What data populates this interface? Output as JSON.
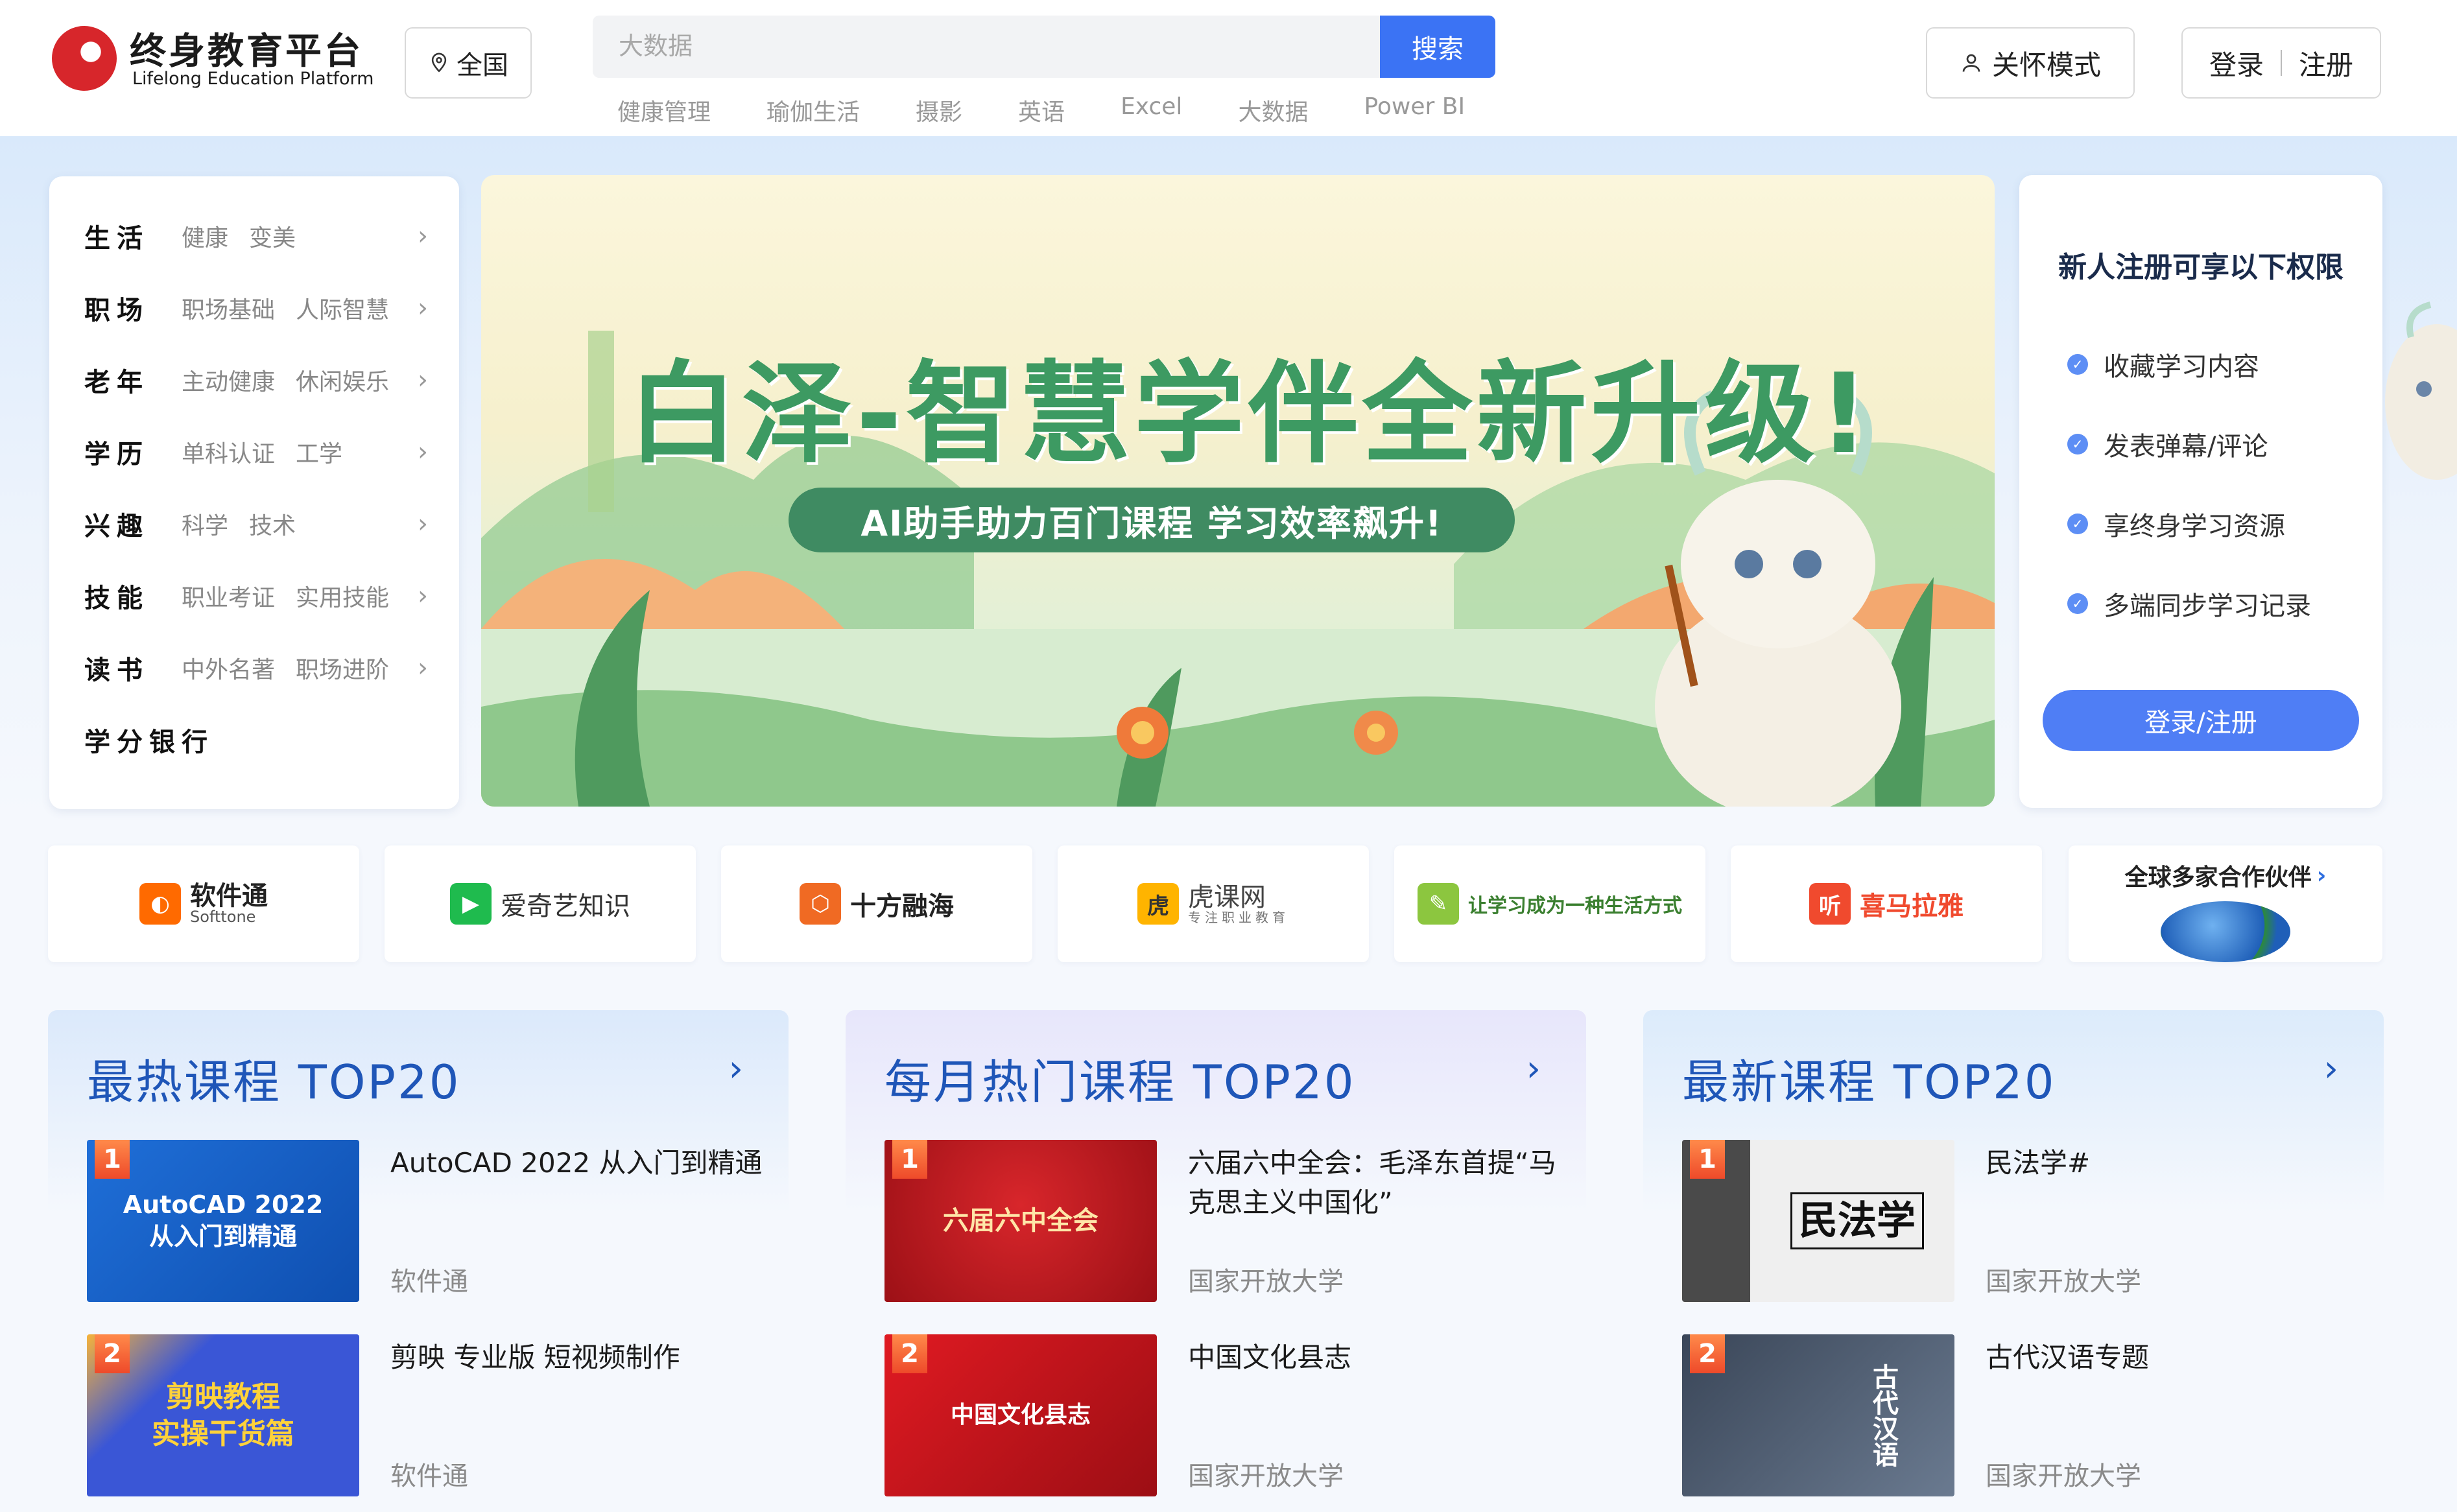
{
  "header": {
    "logo_title": "终身教育平台",
    "logo_subtitle": "Lifelong Education Platform",
    "region_label": "全国",
    "search_placeholder": "大数据",
    "search_button": "搜索",
    "hot_words": [
      "健康管理",
      "瑜伽生活",
      "摄影",
      "英语",
      "Excel",
      "大数据",
      "Power BI"
    ],
    "care_mode": "关怀模式",
    "login": "登录",
    "register": "注册"
  },
  "categories": [
    {
      "name": "生活",
      "subs": [
        "健康",
        "变美"
      ]
    },
    {
      "name": "职场",
      "subs": [
        "职场基础",
        "人际智慧"
      ]
    },
    {
      "name": "老年",
      "subs": [
        "主动健康",
        "休闲娱乐"
      ]
    },
    {
      "name": "学历",
      "subs": [
        "单科认证",
        "工学"
      ]
    },
    {
      "name": "兴趣",
      "subs": [
        "科学",
        "技术"
      ]
    },
    {
      "name": "技能",
      "subs": [
        "职业考证",
        "实用技能"
      ]
    },
    {
      "name": "读书",
      "subs": [
        "中外名著",
        "职场进阶"
      ]
    },
    {
      "name": "学分银行",
      "subs": []
    }
  ],
  "banner": {
    "title": "白泽-智慧学伴全新升级!",
    "subtitle": "AI助手助力百门课程  学习效率飙升!"
  },
  "register_card": {
    "title": "新人注册可享以下权限",
    "perks": [
      "收藏学习内容",
      "发表弹幕/评论",
      "享终身学习资源",
      "多端同步学习记录"
    ],
    "button": "登录/注册"
  },
  "partners": [
    {
      "name": "软件通",
      "sub": "Softtone",
      "color": "#1a1a1a",
      "accent": "#ff6a00"
    },
    {
      "name": "爱奇艺知识",
      "sub": "",
      "color": "#333333",
      "accent": "#1fbb4e"
    },
    {
      "name": "十方融海",
      "sub": "",
      "color": "#222222",
      "accent": "#f06a23"
    },
    {
      "name": "虎课网",
      "sub": "专注职业教育",
      "color": "#444444",
      "accent": "#ffb400"
    },
    {
      "name": "让学习成为一种生活方式",
      "sub": "",
      "color": "#3a7f2f",
      "accent": "#8cc63f"
    },
    {
      "name": "喜马拉雅",
      "sub": "",
      "color": "#f04a2e",
      "accent": "#f04a2e"
    },
    {
      "name": "全球多家合作伙伴",
      "sub": "",
      "color": "#222222",
      "accent": "#2f6fe0"
    }
  ],
  "panels": [
    {
      "title": "最热课程 TOP20",
      "bg_from": "#dbe9fb",
      "courses": [
        {
          "rank": "1",
          "title": "AutoCAD 2022 从入门到精通",
          "org": "软件通",
          "thumb_text": "AutoCAD 2022\n从入门到精通",
          "thumb_bg": "#1f6fd8",
          "thumb_color": "#ffffff"
        },
        {
          "rank": "2",
          "title": "剪映 专业版 短视频制作",
          "org": "软件通",
          "thumb_text": "剪映教程\n实操干货篇",
          "thumb_bg": "#3a56d6",
          "thumb_color": "#ffd23a"
        }
      ]
    },
    {
      "title": "每月热门课程 TOP20",
      "bg_from": "#e7e6fb",
      "courses": [
        {
          "rank": "1",
          "title": "六届六中全会：毛泽东首提“马克思主义中国化”",
          "org": "国家开放大学",
          "thumb_text": "六届六中全会",
          "thumb_bg": "#b8151c",
          "thumb_color": "#ffe6a8"
        },
        {
          "rank": "2",
          "title": "中国文化县志",
          "org": "国家开放大学",
          "thumb_text": "中国文化县志",
          "thumb_bg": "#c8121a",
          "thumb_color": "#ffffff"
        }
      ]
    },
    {
      "title": "最新课程 TOP20",
      "bg_from": "#dcebfb",
      "courses": [
        {
          "rank": "1",
          "title": "民法学#",
          "org": "国家开放大学",
          "thumb_text": "民法学",
          "thumb_bg": "#e9e9e9",
          "thumb_color": "#111111"
        },
        {
          "rank": "2",
          "title": "古代汉语专题",
          "org": "国家开放大学",
          "thumb_text": "古代汉语",
          "thumb_bg": "#4a5a70",
          "thumb_color": "#ffffff"
        }
      ]
    }
  ]
}
